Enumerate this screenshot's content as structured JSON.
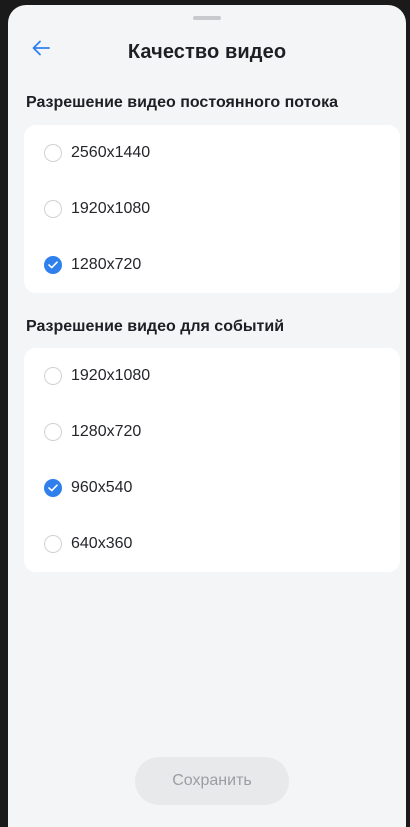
{
  "header": {
    "title": "Качество видео",
    "back_icon": "arrow-left-icon"
  },
  "colors": {
    "accent": "#2f80ed",
    "background": "#f4f5f7",
    "card": "#ffffff",
    "button_disabled_bg": "#e8e9eb",
    "button_disabled_text": "#9a9da3"
  },
  "stream_section": {
    "title": "Разрешение видео постоянного потока",
    "options": [
      {
        "label": "2560x1440",
        "selected": false
      },
      {
        "label": "1920x1080",
        "selected": false
      },
      {
        "label": "1280x720",
        "selected": true
      }
    ]
  },
  "event_section": {
    "title": "Разрешение видео для событий",
    "options": [
      {
        "label": "1920x1080",
        "selected": false
      },
      {
        "label": "1280x720",
        "selected": false
      },
      {
        "label": "960x540",
        "selected": true
      },
      {
        "label": "640x360",
        "selected": false
      }
    ]
  },
  "footer": {
    "save_label": "Сохранить",
    "save_enabled": false
  }
}
